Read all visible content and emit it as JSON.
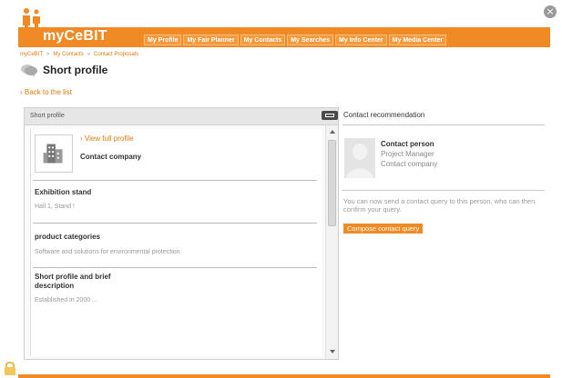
{
  "header": {
    "brand": "myCeBIT",
    "nav": [
      {
        "label": "My Profile"
      },
      {
        "label": "My Fair Planner"
      },
      {
        "label": "My Contacts"
      },
      {
        "label": "My Searches"
      },
      {
        "label": "My Info Center"
      },
      {
        "label": "My Media Center"
      }
    ]
  },
  "breadcrumb": [
    "myCeBIT",
    "My Contacts",
    "Contact Proposals"
  ],
  "page": {
    "title": "Short profile",
    "back_link": "› Back to the list"
  },
  "left_panel": {
    "header": "Short profile",
    "view_full_profile": "› View full profile",
    "company_name": "Contact company",
    "sections": [
      {
        "title": "Exhibition stand",
        "value": "Hall 1, Stand !"
      },
      {
        "title": "product categories",
        "value": "Software and solutions for environmental protection"
      },
      {
        "title": "Short profile and brief description",
        "value": "Established in 2000 ..."
      }
    ]
  },
  "right_panel": {
    "title": "Contact recommendation",
    "contact_name": "Contact person",
    "contact_role": "Project Manager",
    "contact_company": "Contact company",
    "description": "You can now send a contact query to this person, who can then confirm your query.",
    "compose_button": "Compose contact query"
  },
  "colors": {
    "accent": "#f08a24",
    "link": "#e07a10"
  },
  "icons": [
    "close-icon",
    "company-building-icon",
    "speech-bubbles-icon",
    "collapse-panel-icon",
    "lock-icon"
  ]
}
